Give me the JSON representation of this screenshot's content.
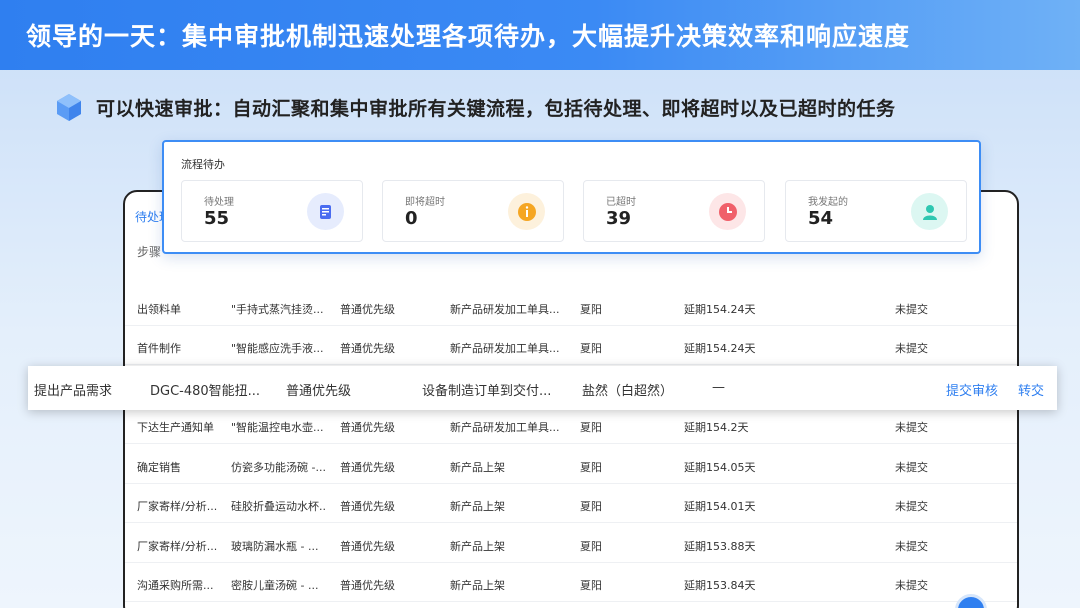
{
  "banner": {
    "title": "领导的一天：集中审批机制迅速处理各项待办，大幅提升决策效率和响应速度"
  },
  "subtitle": "可以快速审批：自动汇聚和集中审批所有关键流程，包括待处理、即将超时以及已超时的任务",
  "table": {
    "active_tab": "待处理",
    "header_first": "步骤",
    "rows": [
      [
        "出领料单",
        "\"手持式蒸汽挂烫...",
        "普通优先级",
        "新产品研发加工单具...",
        "夏阳",
        "延期154.24天",
        "未提交"
      ],
      [
        "首件制作",
        "\"智能感应洗手液...",
        "普通优先级",
        "新产品研发加工单具...",
        "夏阳",
        "延期154.24天",
        "未提交"
      ],
      [
        "下达生产通知单",
        "\"智能温控电水壶...",
        "普通优先级",
        "新产品研发加工单具...",
        "夏阳",
        "延期154.2天",
        "未提交"
      ],
      [
        "确定销售",
        "仿瓷多功能汤碗 -...",
        "普通优先级",
        "新产品上架",
        "夏阳",
        "延期154.05天",
        "未提交"
      ],
      [
        "厂家寄样/分析...",
        "硅胶折叠运动水杯...",
        "普通优先级",
        "新产品上架",
        "夏阳",
        "延期154.01天",
        "未提交"
      ],
      [
        "厂家寄样/分析...",
        "玻璃防漏水瓶 - ...",
        "普通优先级",
        "新产品上架",
        "夏阳",
        "延期153.88天",
        "未提交"
      ],
      [
        "沟通采购所需...",
        "密胺儿童汤碗 - ...",
        "普通优先级",
        "新产品上架",
        "夏阳",
        "延期153.84天",
        "未提交"
      ]
    ]
  },
  "stats": {
    "title": "流程待办",
    "cards": [
      {
        "label": "待处理",
        "value": "55",
        "icon": "document-icon",
        "color": "#4a6cf0",
        "bg": "#e6ecfd"
      },
      {
        "label": "即将超时",
        "value": "0",
        "icon": "info-icon",
        "color": "#f5a623",
        "bg": "#fdf1dc"
      },
      {
        "label": "已超时",
        "value": "39",
        "icon": "clock-icon",
        "color": "#f0606a",
        "bg": "#fde6e7"
      },
      {
        "label": "我发起的",
        "value": "54",
        "icon": "user-icon",
        "color": "#2fc7b1",
        "bg": "#dcf7f2"
      }
    ]
  },
  "highlight": {
    "step": "提出产品需求",
    "product": "DGC-480智能扭...",
    "priority": "普通优先级",
    "process": "设备制造订单到交付...",
    "handler": "盐然（白超然）",
    "delay": "—",
    "submit_link": "提交审核",
    "transfer_link": "转交"
  }
}
